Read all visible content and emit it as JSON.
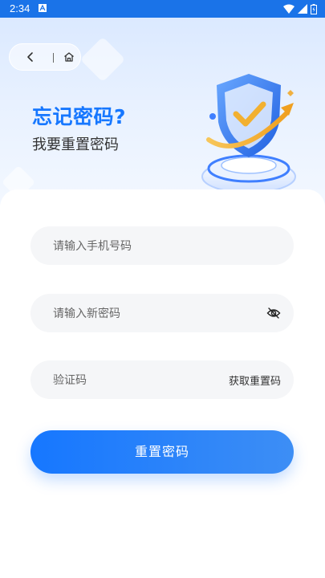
{
  "status_bar": {
    "time": "2:34",
    "icons": [
      "notification-a-icon",
      "wifi-icon",
      "signal-icon",
      "battery-icon"
    ]
  },
  "nav": {
    "icons": [
      "back-chevron-icon",
      "home-icon"
    ]
  },
  "header": {
    "title": "忘记密码?",
    "subtitle": "我要重置密码"
  },
  "form": {
    "phone_placeholder": "请输入手机号码",
    "password_placeholder": "请输入新密码",
    "code_placeholder": "验证码",
    "get_code_label": "获取重置码",
    "submit_label": "重置密码"
  },
  "colors": {
    "accent": "#1677ff",
    "status_bar": "#1a73e8",
    "field_bg": "#f5f6f8"
  }
}
